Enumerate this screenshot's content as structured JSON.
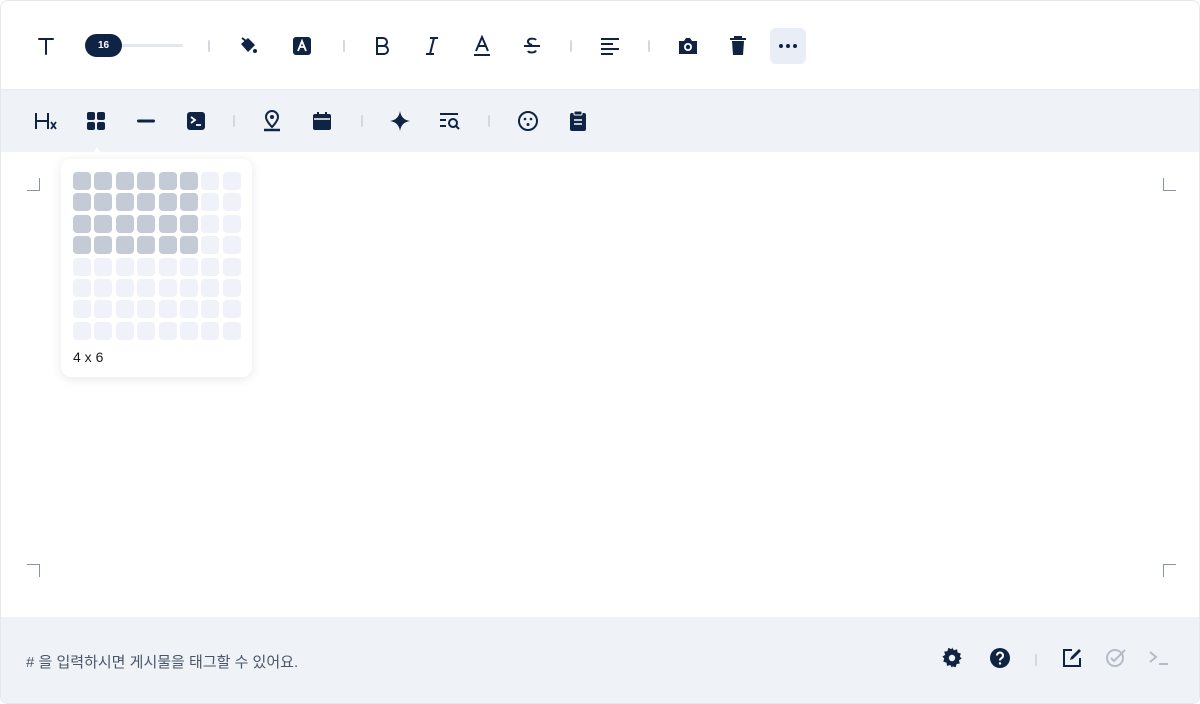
{
  "toolbar1": {
    "font_size": "16",
    "items": [
      "text-icon",
      "font-size-slider",
      "fill-color-icon",
      "text-color-icon",
      "bold-icon",
      "italic-icon",
      "underline-icon",
      "strikethrough-icon",
      "align-left-icon",
      "camera-icon",
      "trash-icon",
      "more-icon"
    ]
  },
  "toolbar2": {
    "items": [
      "heading-icon",
      "table-icon",
      "horizontal-rule-icon",
      "code-block-icon",
      "location-icon",
      "calendar-icon",
      "sparkle-icon",
      "find-replace-icon",
      "emoji-icon",
      "clipboard-icon"
    ]
  },
  "table_picker": {
    "rows": 8,
    "cols": 8,
    "selected_rows": 4,
    "selected_cols": 6,
    "label": "4 x 6"
  },
  "footer": {
    "hint": "# 을 입력하시면 게시물을 태그할 수 있어요.",
    "icons": [
      "settings-icon",
      "help-icon",
      "edit-icon",
      "spellcheck-icon",
      "terminal-icon"
    ]
  },
  "colors": {
    "icon": "#0f2344",
    "toolbar_bg": "#eff3f8",
    "grid_on": "#c4cbd6",
    "grid_off": "#eff2f8"
  }
}
